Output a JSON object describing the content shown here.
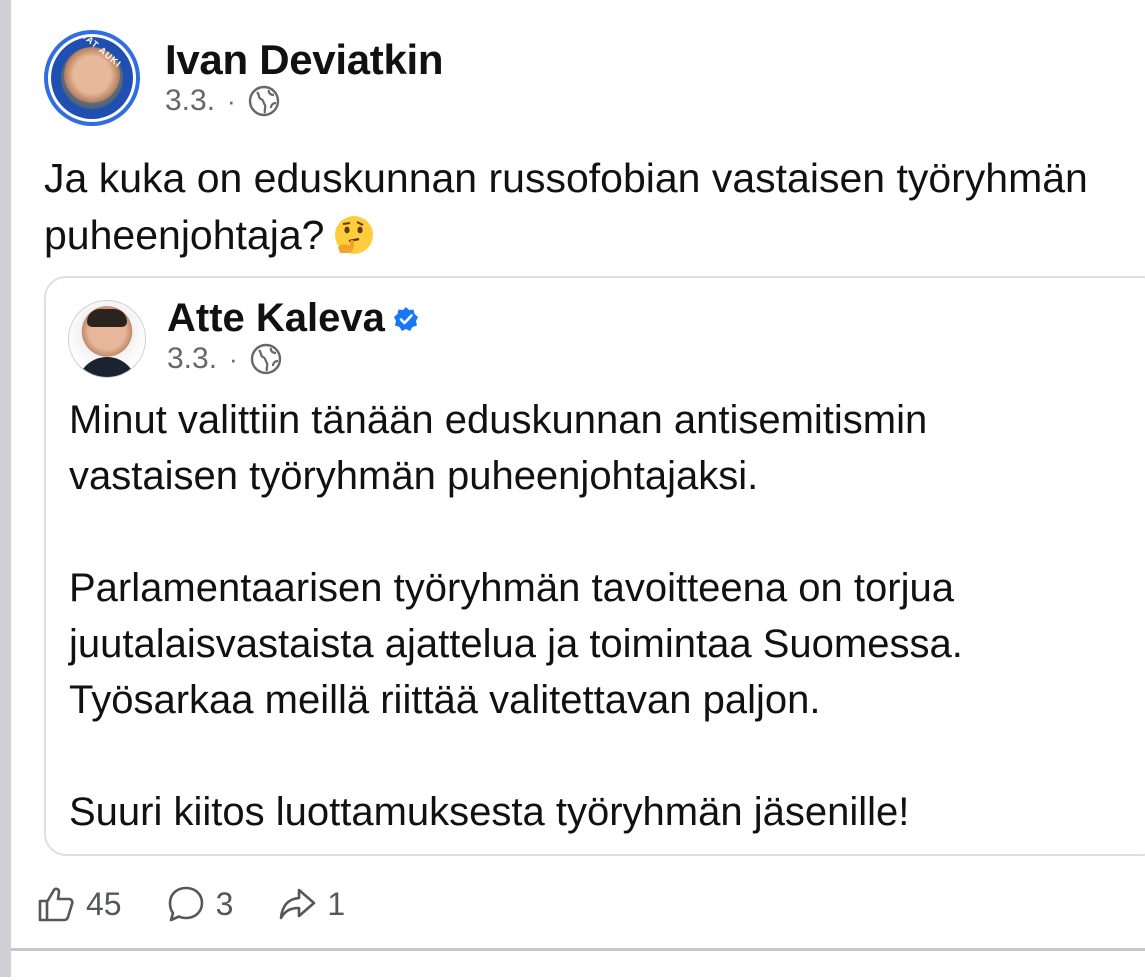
{
  "post": {
    "author": "Ivan Deviatkin",
    "avatar_badge_text": "RAJAT AUKI",
    "date": "3.3.",
    "separator": "·",
    "visibility_icon": "globe-icon",
    "text_line1": "Ja kuka on eduskunnan russofobian vastaisen työryhmän",
    "text_line2": "puheenjohtaja?",
    "emoji": "thinking-face-emoji"
  },
  "shared_post": {
    "author": "Atte Kaleva",
    "verified_icon": "verified-badge-icon",
    "date": "3.3.",
    "separator": "·",
    "visibility_icon": "globe-icon",
    "paragraph1_lines": [
      "Minut valittiin tänään eduskunnan antisemitismin",
      "vastaisen työryhmän puheenjohtajaksi."
    ],
    "paragraph2_lines": [
      "Parlamentaarisen työryhmän tavoitteena on torjua",
      "juutalaisvastaista ajattelua ja toimintaa Suomessa.",
      "Työsarkaa meillä riittää valitettavan paljon."
    ],
    "paragraph3_lines": [
      "Suuri kiitos luottamuksesta työryhmän jäsenille!"
    ]
  },
  "actions": {
    "likes": "45",
    "comments": "3",
    "shares": "1"
  },
  "colors": {
    "accent_blue": "#2f6de0",
    "verified_blue": "#1877f2",
    "meta_gray": "#65676b"
  }
}
